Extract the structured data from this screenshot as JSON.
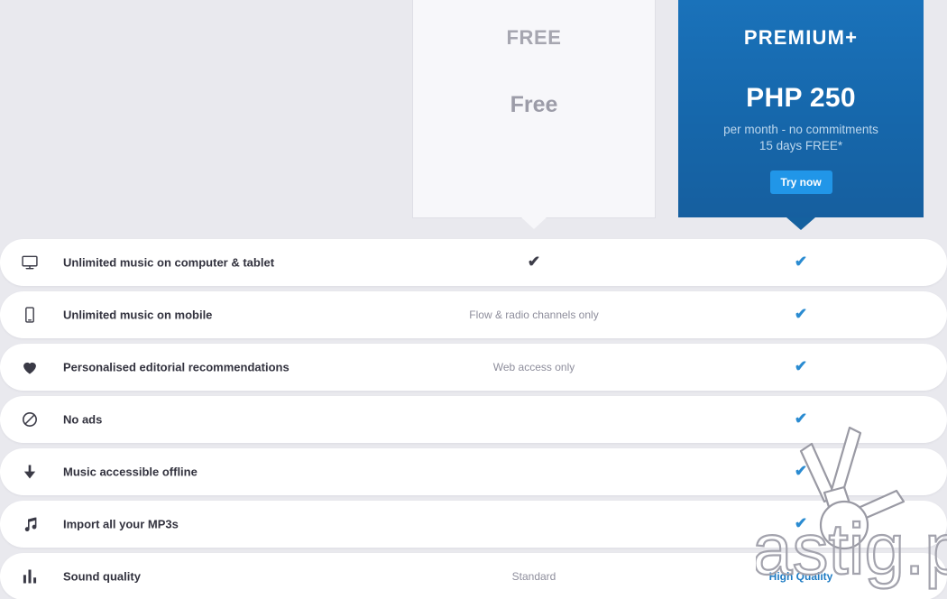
{
  "plans": {
    "free": {
      "name": "FREE",
      "price": "Free"
    },
    "premium": {
      "name": "PREMIUM+",
      "price": "PHP 250",
      "sub_line1": "per month - no commitments",
      "sub_line2": "15 days FREE*",
      "cta_label": "Try now",
      "accent_color": "#1668b0",
      "cta_color": "#2196e8"
    }
  },
  "features": [
    {
      "icon": "monitor-icon",
      "label": "Unlimited music on computer & tablet",
      "free": {
        "type": "check",
        "text": "✔"
      },
      "premium": {
        "type": "check",
        "text": "✔"
      }
    },
    {
      "icon": "mobile-icon",
      "label": "Unlimited music on mobile",
      "free": {
        "type": "text",
        "text": "Flow & radio channels only"
      },
      "premium": {
        "type": "check",
        "text": "✔"
      }
    },
    {
      "icon": "heart-icon",
      "label": "Personalised editorial recommendations",
      "free": {
        "type": "text",
        "text": "Web access only"
      },
      "premium": {
        "type": "check",
        "text": "✔"
      }
    },
    {
      "icon": "no-ads-icon",
      "label": "No ads",
      "free": {
        "type": "empty",
        "text": ""
      },
      "premium": {
        "type": "check",
        "text": "✔"
      }
    },
    {
      "icon": "download-icon",
      "label": "Music accessible offline",
      "free": {
        "type": "empty",
        "text": ""
      },
      "premium": {
        "type": "check",
        "text": "✔"
      }
    },
    {
      "icon": "music-note-icon",
      "label": "Import all your MP3s",
      "free": {
        "type": "empty",
        "text": ""
      },
      "premium": {
        "type": "check",
        "text": "✔"
      }
    },
    {
      "icon": "bar-chart-icon",
      "label": "Sound quality",
      "free": {
        "type": "text",
        "text": "Standard"
      },
      "premium": {
        "type": "text",
        "text": "High Quality"
      }
    }
  ],
  "watermark": {
    "text": "astig.ph"
  }
}
